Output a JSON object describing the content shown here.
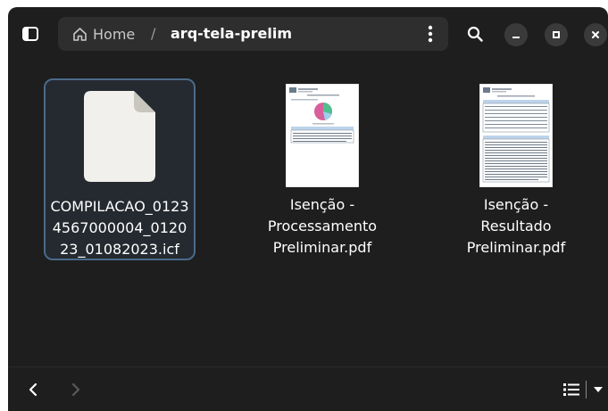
{
  "header": {
    "breadcrumb": {
      "home_label": "Home",
      "separator": "/",
      "current": "arq-tela-prelim"
    }
  },
  "files": [
    {
      "name": "COMPILACAO_01234567000004_012023_01082023.icf",
      "display": "COMPILACAO_0123\n4567000004_0120\n23_01082023.icf",
      "selected": true,
      "icon": "generic-file-icon"
    },
    {
      "name": "Isenção - Processamento Preliminar.pdf",
      "display": "Isenção -\nProcessamento\nPreliminar.pdf",
      "selected": false,
      "icon": "pdf-thumbnail"
    },
    {
      "name": "Isenção - Resultado Preliminar.pdf",
      "display": "Isenção -\nResultado\nPreliminar.pdf",
      "selected": false,
      "icon": "pdf-thumbnail"
    }
  ],
  "colors": {
    "window_bg": "#1e1e1e",
    "pathbar_bg": "#2e2e2e",
    "selection_border": "#4a6a8a",
    "text": "#ffffff"
  }
}
